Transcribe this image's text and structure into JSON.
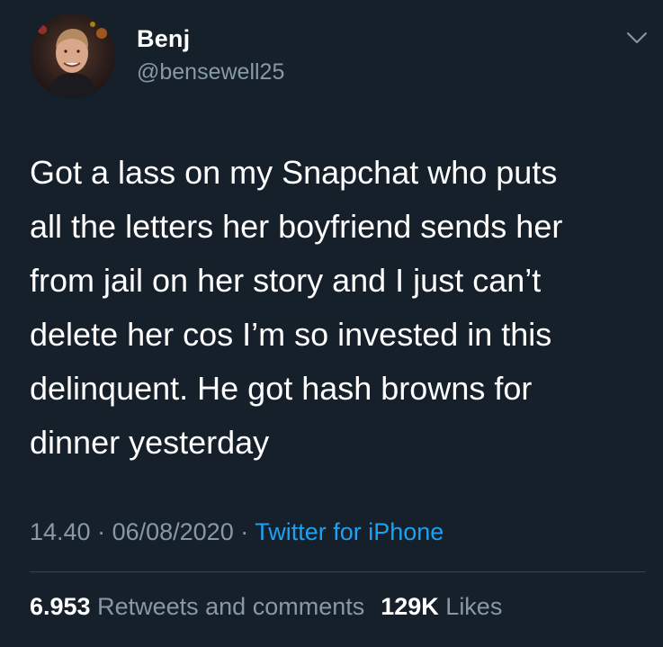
{
  "tweet": {
    "author": {
      "name": "Benj",
      "handle": "@bensewell25"
    },
    "text": "Got a lass on my Snapchat who puts\nall the letters her boyfriend sends her\nfrom jail on her story and I just can’t\ndelete her cos I’m so invested in this\ndelinquent. He got hash browns for\ndinner yesterday",
    "time": "14.40",
    "date": "06/08/2020",
    "separator": " · ",
    "source": "Twitter for iPhone",
    "stats": {
      "retweets_count": "6.953",
      "retweets_label": "Retweets and comments",
      "likes_count": "129K",
      "likes_label": "Likes"
    }
  },
  "colors": {
    "background": "#15202b",
    "primary_text": "#ffffff",
    "secondary_text": "#8899a6",
    "accent": "#1da1f2",
    "divider": "#38444d"
  },
  "icons": {
    "menu": "chevron-down-icon"
  }
}
